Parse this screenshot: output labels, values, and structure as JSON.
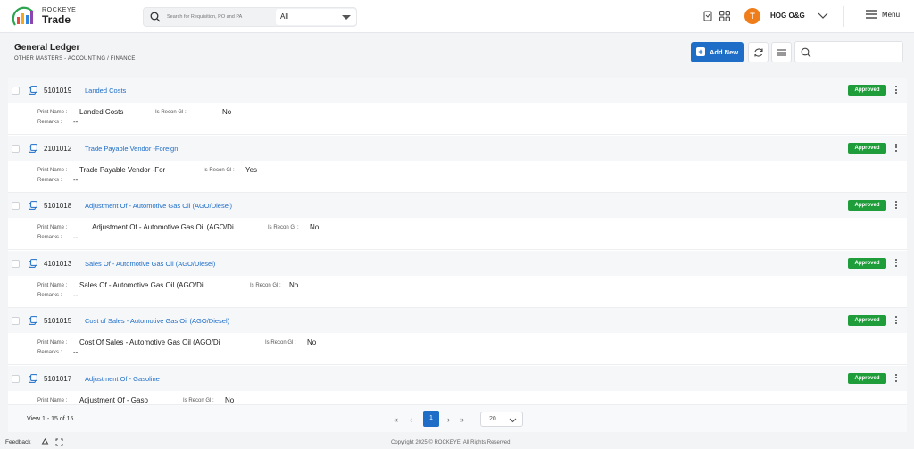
{
  "app": {
    "brand_top": "ROCKEYE",
    "brand_bottom": "Trade",
    "search_placeholder": "Search for Requisition, PO and PA",
    "search_scope": "All",
    "user_initial": "T",
    "org_name": "HOG O&G",
    "menu_label": "Menu"
  },
  "page": {
    "title": "General Ledger",
    "breadcrumb": "OTHER MASTERS -  ACCOUNTING / FINANCE",
    "add_label": "Add New"
  },
  "labels": {
    "print_name": "Print Name :",
    "recon": "Is Recon Gl :",
    "remarks": "Remarks :"
  },
  "records": [
    {
      "code": "5101019",
      "name": "Landed Costs",
      "print_name": "Landed Costs",
      "recon": "No",
      "remarks": "--",
      "status": "Approved"
    },
    {
      "code": "2101012",
      "name": "Trade Payable Vendor -Foreign",
      "print_name": "Trade Payable Vendor -For",
      "recon": "Yes",
      "remarks": "--",
      "status": "Approved"
    },
    {
      "code": "5101018",
      "name": "Adjustment Of - Automotive Gas Oil (AGO/Diesel)",
      "print_name": "Adjustment Of - Automotive Gas Oil (AGO/Di",
      "recon": "No",
      "remarks": "--",
      "status": "Approved"
    },
    {
      "code": "4101013",
      "name": "Sales Of - Automotive Gas Oil (AGO/Diesel)",
      "print_name": "Sales Of - Automotive Gas Oil (AGO/Di",
      "recon": "No",
      "remarks": "--",
      "status": "Approved"
    },
    {
      "code": "5101015",
      "name": "Cost of Sales - Automotive Gas Oil (AGO/Diesel)",
      "print_name": "Cost Of Sales - Automotive Gas Oil (AGO/Di",
      "recon": "No",
      "remarks": "--",
      "status": "Approved"
    },
    {
      "code": "5101017",
      "name": "Adjustment Of - Gasoline",
      "print_name": "Adjustment Of - Gaso",
      "recon": "No",
      "remarks": "--",
      "status": "Approved"
    }
  ],
  "pager": {
    "view_text": "View 1 - 15 of 15",
    "current_page": "1",
    "page_size": "20"
  },
  "footer": {
    "feedback": "Feedback",
    "copyright": "Copyright 2025 © ROCKEYE. All Rights Reserved"
  },
  "colors": {
    "accent": "#1e6ec8",
    "approved": "#1f9d3a",
    "avatar": "#ef7d1a"
  }
}
